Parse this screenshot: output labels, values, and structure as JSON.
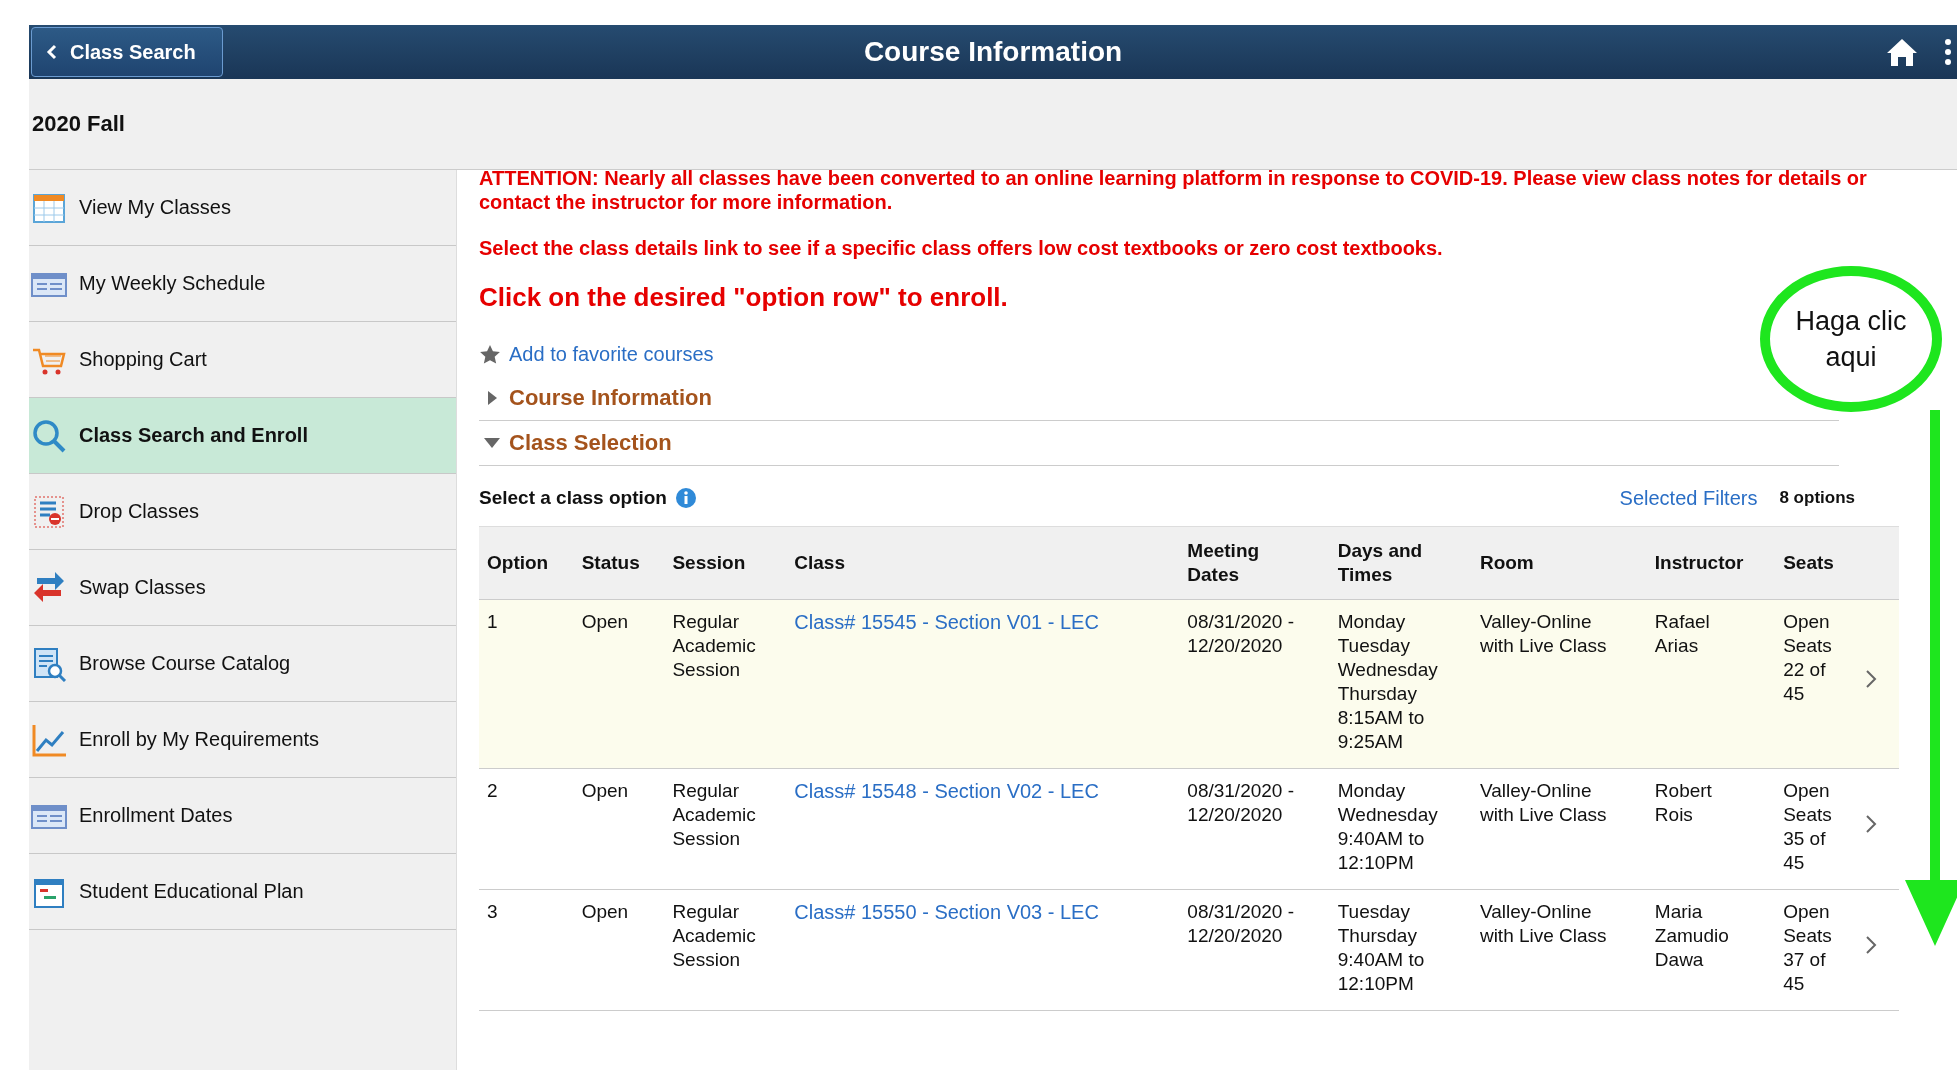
{
  "header": {
    "back_button": "Class Search",
    "title": "Course Information"
  },
  "term": "2020 Fall",
  "sidebar": {
    "items": [
      {
        "label": "View My Classes",
        "selected": false
      },
      {
        "label": "My Weekly Schedule",
        "selected": false
      },
      {
        "label": "Shopping Cart",
        "selected": false
      },
      {
        "label": "Class Search and Enroll",
        "selected": true
      },
      {
        "label": "Drop Classes",
        "selected": false
      },
      {
        "label": "Swap Classes",
        "selected": false
      },
      {
        "label": "Browse Course Catalog",
        "selected": false
      },
      {
        "label": "Enroll by My Requirements",
        "selected": false
      },
      {
        "label": "Enrollment Dates",
        "selected": false
      },
      {
        "label": "Student Educational Plan",
        "selected": false
      }
    ]
  },
  "notices": [
    "ATTENTION: Nearly all classes have been converted to an online learning platform in response to COVID-19. Please view class notes for details or contact the instructor for more information.",
    "Select the class details link to see if a specific class offers low cost textbooks or zero cost textbooks."
  ],
  "instruction": "Click on the desired \"option row\" to enroll.",
  "favorite_link": "Add to favorite courses",
  "sections": [
    {
      "title": "Course Information",
      "expanded": false
    },
    {
      "title": "Class Selection",
      "expanded": true
    }
  ],
  "class_selection": {
    "label": "Select a class option",
    "filters_link": "Selected Filters",
    "count": "8 options"
  },
  "table": {
    "columns": [
      "Option",
      "Status",
      "Session",
      "Class",
      "Meeting\nDates",
      "Days and\nTimes",
      "Room",
      "Instructor",
      "Seats"
    ],
    "rows": [
      {
        "option": "1",
        "status": "Open",
        "session": "Regular\nAcademic\nSession",
        "class": "Class# 15545 - Section V01 - LEC",
        "dates": "08/31/2020 -\n12/20/2020",
        "days_times": "Monday\nTuesday\nWednesday\nThursday\n8:15AM to\n9:25AM",
        "room": "Valley-Online\nwith Live Class",
        "instructor": "Rafael\nArias",
        "seats": "Open\nSeats\n22 of\n45",
        "selected": true
      },
      {
        "option": "2",
        "status": "Open",
        "session": "Regular\nAcademic\nSession",
        "class": "Class# 15548 - Section V02 - LEC",
        "dates": "08/31/2020 -\n12/20/2020",
        "days_times": "Monday\nWednesday\n9:40AM to\n12:10PM",
        "room": "Valley-Online\nwith Live Class",
        "instructor": "Robert\nRois",
        "seats": "Open\nSeats\n35 of\n45",
        "selected": false
      },
      {
        "option": "3",
        "status": "Open",
        "session": "Regular\nAcademic\nSession",
        "class": "Class# 15550 - Section V03 - LEC",
        "dates": "08/31/2020 -\n12/20/2020",
        "days_times": "Tuesday\nThursday\n9:40AM to\n12:10PM",
        "room": "Valley-Online\nwith Live Class",
        "instructor": "Maria\nZamudio\nDawa",
        "seats": "Open\nSeats\n37 of\n45",
        "selected": false
      }
    ]
  },
  "annotation": {
    "text": "Haga clic\naqui"
  }
}
